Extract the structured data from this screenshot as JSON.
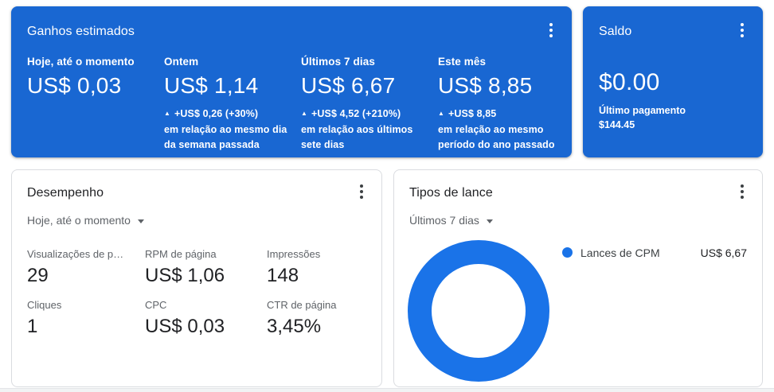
{
  "colors": {
    "card_blue": "#1967d2",
    "chart_blue": "#1a73e8",
    "card_border": "#dadce0",
    "text_primary": "#202124",
    "text_secondary": "#5f6368"
  },
  "estimated_earnings_card": {
    "title": "Ganhos estimados",
    "menu_icon": "kebab-menu-icon",
    "columns": [
      {
        "label": "Hoje, até o momento",
        "value": "US$ 0,03"
      },
      {
        "label": "Ontem",
        "value": "US$ 1,14",
        "change": {
          "arrow": "▲",
          "lines": [
            "+US$ 0,26 (+30%)",
            "em relação ao mesmo dia",
            "da semana passada"
          ]
        }
      },
      {
        "label": "Últimos 7 dias",
        "value": "US$ 6,67",
        "change": {
          "arrow": "▲",
          "lines": [
            "+US$ 4,52 (+210%)",
            "em relação aos últimos",
            "sete dias"
          ]
        }
      },
      {
        "label": "Este mês",
        "value": "US$ 8,85",
        "change": {
          "arrow": "▲",
          "lines": [
            "+US$ 8,85",
            "em relação ao mesmo",
            "período do ano passado"
          ]
        }
      }
    ]
  },
  "balance_card": {
    "title": "Saldo",
    "menu_icon": "kebab-menu-icon",
    "value": "$0.00",
    "last_payment_label": "Último pagamento",
    "last_payment_value": "$144.45"
  },
  "performance_card": {
    "title": "Desempenho",
    "menu_icon": "kebab-menu-icon",
    "period_selector": "Hoje, até o momento",
    "metrics": [
      {
        "label": "Visualizações de p…",
        "value": "29"
      },
      {
        "label": "RPM de página",
        "value": "US$ 1,06"
      },
      {
        "label": "Impressões",
        "value": "148"
      },
      {
        "label": "Cliques",
        "value": "1"
      },
      {
        "label": "CPC",
        "value": "US$ 0,03"
      },
      {
        "label": "CTR de página",
        "value": "3,45%"
      }
    ]
  },
  "bid_types_card": {
    "title": "Tipos de lance",
    "menu_icon": "kebab-menu-icon",
    "period_selector": "Últimos 7 dias"
  },
  "chart_data": {
    "type": "pie",
    "donut": true,
    "title": "Tipos de lance",
    "period": "Últimos 7 dias",
    "legend_position": "right",
    "series": [
      {
        "name": "Lances de CPM",
        "display_value": "US$ 6,67",
        "value": 6.67,
        "fraction": 1.0,
        "color": "#1a73e8"
      }
    ]
  }
}
